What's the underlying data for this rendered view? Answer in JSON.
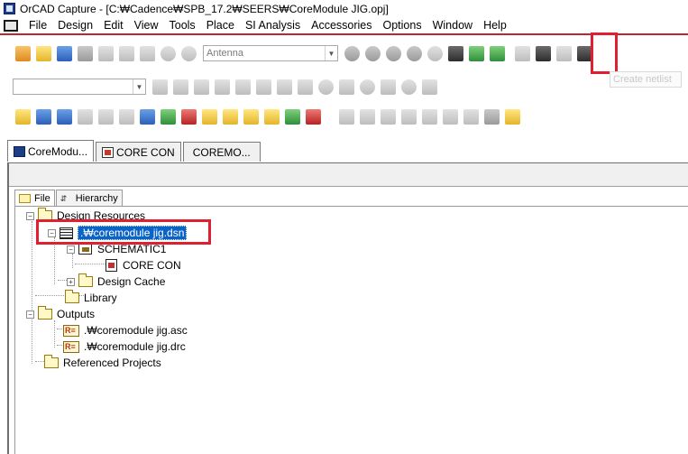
{
  "window": {
    "title": "OrCAD Capture - [C:₩Cadence₩SPB_17.2₩SEERS₩CoreModule JIG.opj]"
  },
  "menu": {
    "items": [
      "File",
      "Design",
      "Edit",
      "View",
      "Tools",
      "Place",
      "SI Analysis",
      "Accessories",
      "Options",
      "Window",
      "Help"
    ]
  },
  "toolbar": {
    "search_combo_value": "Antenna",
    "tooltip": "Create netlist"
  },
  "doc_tabs": [
    {
      "label": "CoreModu..."
    },
    {
      "label": "CORE CON"
    },
    {
      "label": "COREMO..."
    }
  ],
  "panel_tabs": {
    "file": "File",
    "hierarchy": "Hierarchy"
  },
  "tree": {
    "design_resources": "Design Resources",
    "design_file": ".₩coremodule jig.dsn",
    "schematic": "SCHEMATIC1",
    "page": "CORE CON",
    "design_cache": "Design Cache",
    "library": "Library",
    "outputs": "Outputs",
    "output_files": [
      ".₩coremodule jig.asc",
      ".₩coremodule jig.drc"
    ],
    "referenced_projects": "Referenced Projects"
  },
  "colors": {
    "highlight": "#e02030",
    "selection": "#0a64c8"
  }
}
